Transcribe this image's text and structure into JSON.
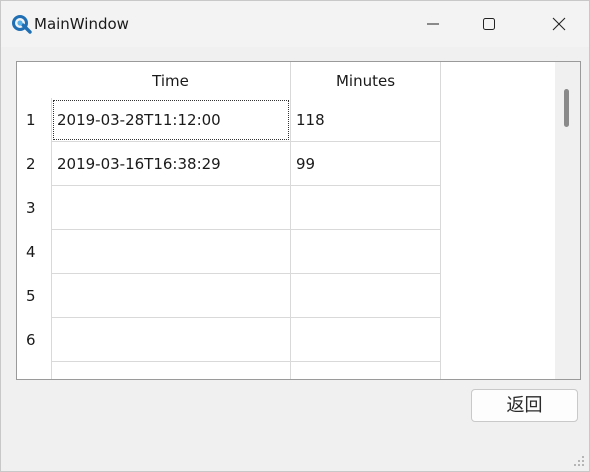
{
  "window": {
    "title": "MainWindow",
    "icon": "app-window-icon",
    "controls": {
      "minimize": "minimize-icon",
      "maximize": "maximize-icon",
      "close": "close-icon"
    }
  },
  "table": {
    "columns": [
      "Time",
      "Minutes"
    ],
    "row_numbers": [
      "1",
      "2",
      "3",
      "4",
      "5",
      "6"
    ],
    "rows": [
      {
        "time": "2019-03-28T11:12:00",
        "minutes": "118"
      },
      {
        "time": "2019-03-16T16:38:29",
        "minutes": "99"
      },
      {
        "time": "",
        "minutes": ""
      },
      {
        "time": "",
        "minutes": ""
      },
      {
        "time": "",
        "minutes": ""
      },
      {
        "time": "",
        "minutes": ""
      },
      {
        "time": "",
        "minutes": ""
      }
    ]
  },
  "buttons": {
    "back_label": "返回"
  },
  "colors": {
    "accent": "#1f6fb5",
    "window_bg": "#f0f0f0",
    "grid_line": "#d9d9d9"
  }
}
